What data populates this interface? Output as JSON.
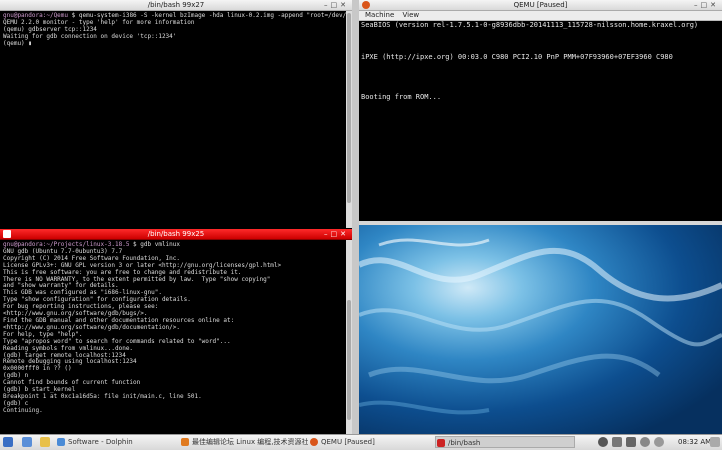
{
  "term_top": {
    "title": "/bin/bash 99x27",
    "lines": [
      {
        "p": "gnu@pandora:~/Qemu",
        "t": " $ qemu-system-i386 -S -kernel bzImage -hda linux-0.2.img -append \"root=/dev/hda\""
      },
      {
        "p": "",
        "t": "QEMU 2.2.0 monitor - type 'help' for more information"
      },
      {
        "p": "",
        "t": "(qemu) gdbserver tcp::1234"
      },
      {
        "p": "",
        "t": "Waiting for gdb connection on device 'tcp::1234'"
      },
      {
        "p": "",
        "t": "(qemu) ▮"
      }
    ]
  },
  "term_bottom": {
    "title": "/bin/bash 99x25",
    "lines": [
      {
        "p": "gnu@pandora:~/Projects/linux-3.18.5",
        "t": " $ gdb vmlinux"
      },
      {
        "p": "",
        "t": "GNU gdb (Ubuntu 7.7-0ubuntu3) 7.7"
      },
      {
        "p": "",
        "t": "Copyright (C) 2014 Free Software Foundation, Inc."
      },
      {
        "p": "",
        "t": "License GPLv3+: GNU GPL version 3 or later <http://gnu.org/licenses/gpl.html>"
      },
      {
        "p": "",
        "t": "This is free software: you are free to change and redistribute it."
      },
      {
        "p": "",
        "t": "There is NO WARRANTY, to the extent permitted by law.  Type \"show copying\""
      },
      {
        "p": "",
        "t": "and \"show warranty\" for details."
      },
      {
        "p": "",
        "t": "This GDB was configured as \"i686-linux-gnu\"."
      },
      {
        "p": "",
        "t": "Type \"show configuration\" for configuration details."
      },
      {
        "p": "",
        "t": "For bug reporting instructions, please see:"
      },
      {
        "p": "",
        "t": "<http://www.gnu.org/software/gdb/bugs/>."
      },
      {
        "p": "",
        "t": "Find the GDB manual and other documentation resources online at:"
      },
      {
        "p": "",
        "t": "<http://www.gnu.org/software/gdb/documentation/>."
      },
      {
        "p": "",
        "t": "For help, type \"help\"."
      },
      {
        "p": "",
        "t": "Type \"apropos word\" to search for commands related to \"word\"..."
      },
      {
        "p": "",
        "t": "Reading symbols from vmlinux...done."
      },
      {
        "p": "",
        "t": "(gdb) target remote localhost:1234"
      },
      {
        "p": "",
        "t": "Remote debugging using localhost:1234"
      },
      {
        "p": "",
        "t": "0x0000fff0 in ?? ()"
      },
      {
        "p": "",
        "t": "(gdb) n"
      },
      {
        "p": "",
        "t": "Cannot find bounds of current function"
      },
      {
        "p": "",
        "t": "(gdb) b start_kernel"
      },
      {
        "p": "",
        "t": "Breakpoint 1 at 0xc1a16d5a: file init/main.c, line 501."
      },
      {
        "p": "",
        "t": "(gdb) c"
      },
      {
        "p": "",
        "t": "Continuing."
      }
    ]
  },
  "qemu": {
    "title": "QEMU [Paused]",
    "menu": [
      "Machine",
      "View"
    ],
    "screen_lines": [
      "SeaBIOS (version rel-1.7.5.1-0-g8936dbb-20141113_115728-nilsson.home.kraxel.org)",
      "",
      "",
      "",
      "iPXE (http://ipxe.org) 00:03.0 C980 PCI2.10 PnP PMM+07F93960+07EF3960 C980",
      "",
      "",
      "",
      "",
      "Booting from ROM..."
    ]
  },
  "taskbar": {
    "tasks": [
      {
        "label": "Software - Dolphin",
        "icon": "folder-icon",
        "color": "#4a8bd6"
      },
      {
        "label": "最佳编辑论坛 Linux 编程,技术资源社区",
        "icon": "browser-icon",
        "color": "#e07a1f"
      },
      {
        "label": "QEMU [Paused]",
        "icon": "qemu-icon",
        "color": "#d9551a"
      },
      {
        "label": "/bin/bash",
        "icon": "terminal-icon",
        "color": "#cc2222"
      }
    ],
    "clock": "08:32 AM"
  }
}
